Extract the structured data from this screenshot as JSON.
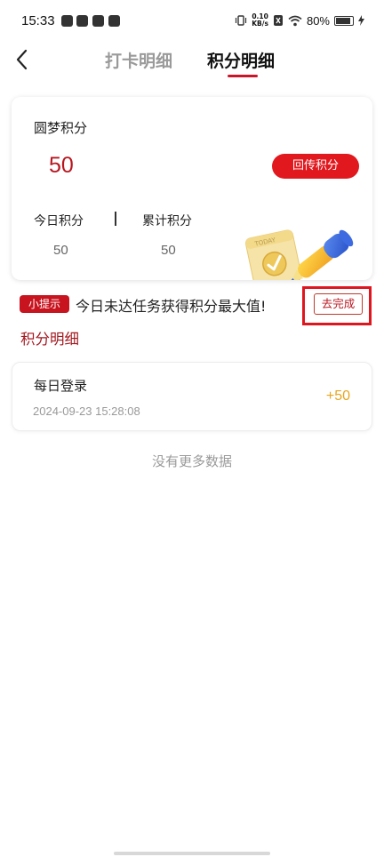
{
  "status_bar": {
    "time": "15:33",
    "network_speed_value": "0.10",
    "network_speed_unit": "KB/s",
    "battery_percent": "80%",
    "battery_level": 0.8
  },
  "header": {
    "tabs": [
      {
        "label": "打卡明细",
        "active": false
      },
      {
        "label": "积分明细",
        "active": true
      }
    ]
  },
  "points_card": {
    "title": "圆梦积分",
    "value": "50",
    "upload_button": "回传积分",
    "today_label": "今日积分",
    "today_value": "50",
    "total_label": "累计积分",
    "total_value": "50",
    "illustration_text": "TODAY"
  },
  "tip": {
    "badge": "小提示",
    "text": "今日未达任务获得积分最大值!",
    "button": "去完成"
  },
  "section_title": "积分明细",
  "records": [
    {
      "title": "每日登录",
      "time": "2024-09-23 15:28:08",
      "points": "+50"
    }
  ],
  "no_more_text": "没有更多数据",
  "colors": {
    "accent": "#e1181e",
    "dark_red": "#b8161f",
    "gold": "#e7a51f"
  }
}
